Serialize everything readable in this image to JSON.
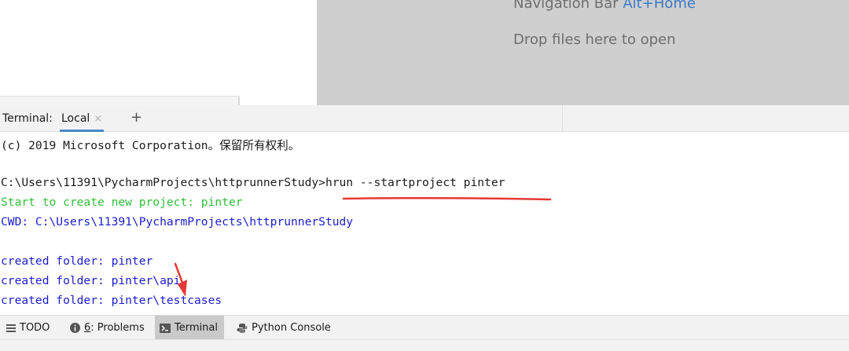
{
  "editor": {
    "nav_prefix": "Navigation Bar ",
    "nav_shortcut": "Alt+Home",
    "drop_hint": "Drop files here to open"
  },
  "terminal": {
    "title": "Terminal:",
    "tab_label": "Local",
    "close_glyph": "×",
    "add_glyph": "+"
  },
  "output": [
    {
      "text": "(c) 2019 Microsoft Corporation。保留所有权利。",
      "color": "black"
    },
    {
      "text": "",
      "color": "black"
    },
    {
      "text": "C:\\Users\\11391\\PycharmProjects\\httprunnerStudy>hrun --startproject pinter",
      "color": "black"
    },
    {
      "text": "Start to create new project: pinter",
      "color": "green"
    },
    {
      "text": "CWD: C:\\Users\\11391\\PycharmProjects\\httprunnerStudy",
      "color": "blue"
    },
    {
      "text": "",
      "color": "black"
    },
    {
      "text": "created folder: pinter",
      "color": "blue"
    },
    {
      "text": "created folder: pinter\\api",
      "color": "blue"
    },
    {
      "text": "created folder: pinter\\testcases",
      "color": "blue"
    }
  ],
  "toolbar": {
    "todo": "TODO",
    "problems_num": "6",
    "problems_rest": ": Problems",
    "terminal": "Terminal",
    "python_console": "Python Console"
  },
  "colors": {
    "accent": "#4a88c7",
    "green": "#2fbf3a",
    "blue": "#1c1ccc",
    "annotation": "#e53935"
  }
}
